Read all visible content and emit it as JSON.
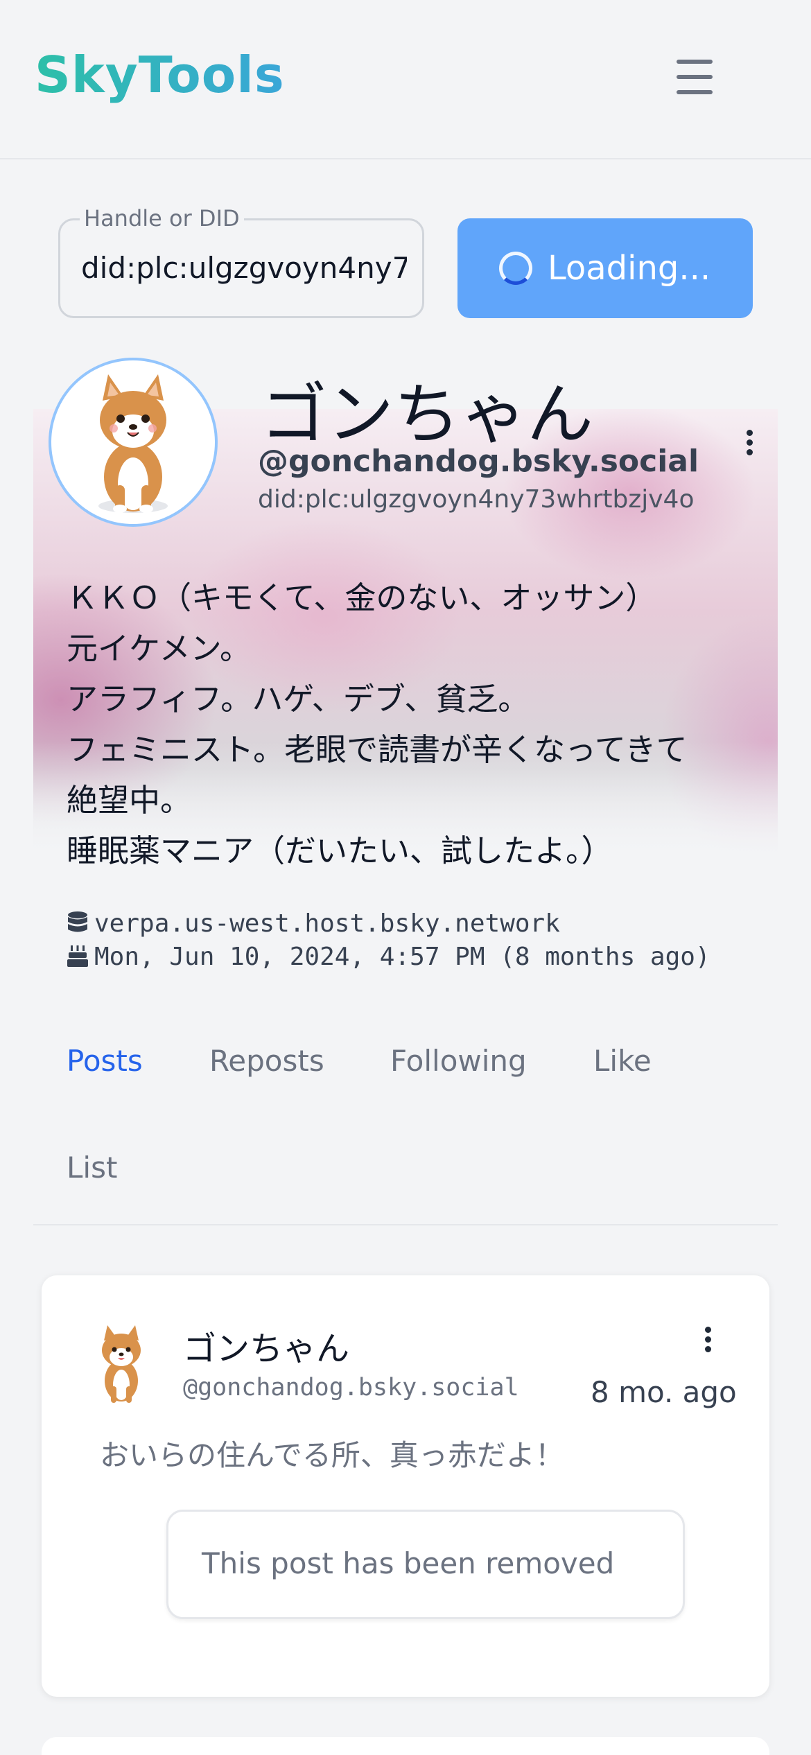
{
  "header": {
    "logo": "SkyTools",
    "menu_icon": "hamburger-menu-icon"
  },
  "search": {
    "label": "Handle or DID",
    "value": "did:plc:ulgzgvoyn4ny73whrtbzjv4o",
    "button_label": "Loading...",
    "button_color": "#60a5fa"
  },
  "profile": {
    "display_name": "ゴンちゃん",
    "handle": "@gonchandog.bsky.social",
    "did": "did:plc:ulgzgvoyn4ny73whrtbzjv4o",
    "bio": "ＫＫＯ（キモくて、金のない、オッサン）\n元イケメン。\nアラフィフ。ハゲ、デブ、貧乏。\nフェミニスト。老眼で読書が辛くなってきて\n絶望中。\n睡眠薬マニア（だいたい、試したよ。）",
    "pds_host": "verpa.us-west.host.bsky.network",
    "created": "Mon, Jun 10, 2024, 4:57 PM (8 months ago)"
  },
  "tabs": [
    {
      "label": "Posts",
      "active": true
    },
    {
      "label": "Reposts",
      "active": false
    },
    {
      "label": "Following",
      "active": false
    },
    {
      "label": "Like",
      "active": false
    },
    {
      "label": "List",
      "active": false
    }
  ],
  "posts": [
    {
      "author_name": "ゴンちゃん",
      "author_handle": "@gonchandog.bsky.social",
      "time": "8 mo. ago",
      "text": "おいらの住んでる所、真っ赤だよ！",
      "embed_notice": "This post has been removed"
    }
  ],
  "colors": {
    "accent": "#2563eb",
    "background": "#f3f4f6"
  }
}
